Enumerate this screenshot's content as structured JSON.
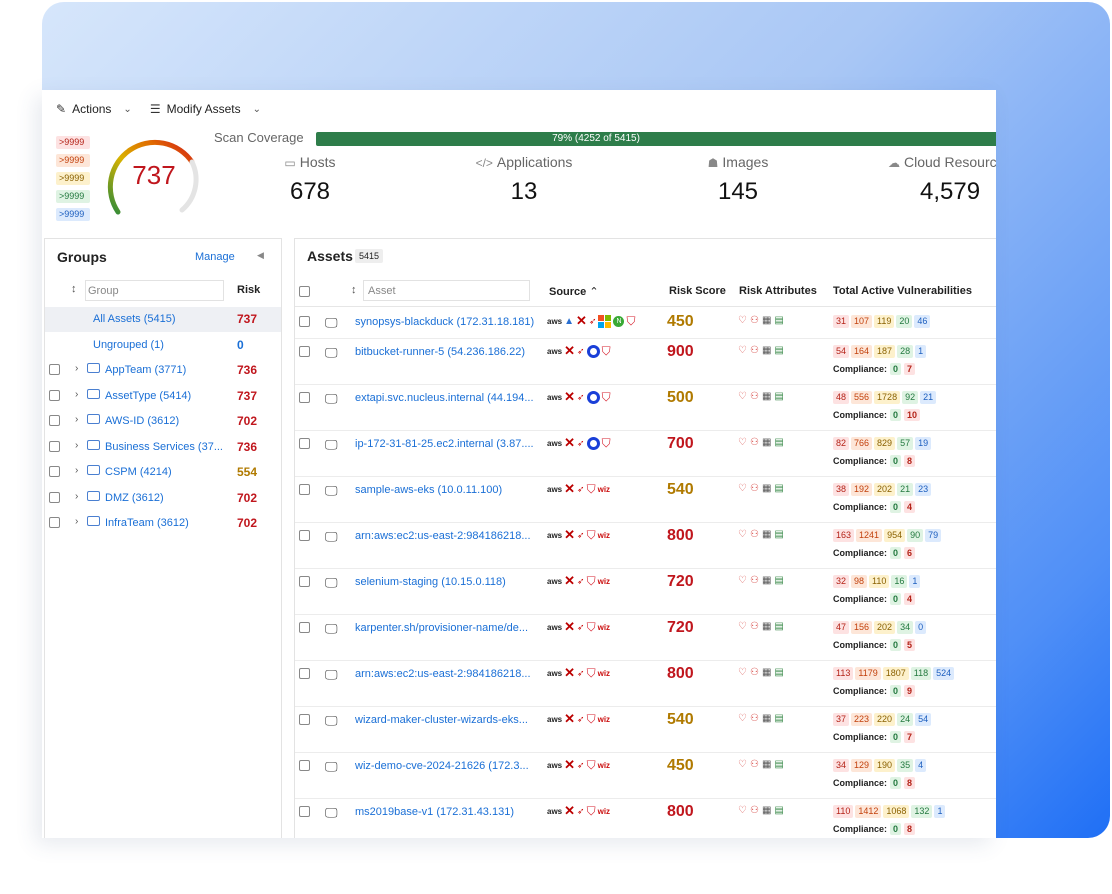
{
  "toolbar": {
    "actions_label": "Actions",
    "modify_label": "Modify Assets"
  },
  "legend": [
    {
      "label": ">9999",
      "color": "#b42318",
      "bg": "#fde2e2"
    },
    {
      "label": ">9999",
      "color": "#c2410c",
      "bg": "#fde6d8"
    },
    {
      "label": ">9999",
      "color": "#8a6100",
      "bg": "#fdf1cc"
    },
    {
      "label": ">9999",
      "color": "#23793f",
      "bg": "#dff3e3"
    },
    {
      "label": ">9999",
      "color": "#1d5fbf",
      "bg": "#dceafd"
    }
  ],
  "gauge": {
    "value": "737"
  },
  "scan": {
    "label": "Scan Coverage",
    "text": "79% (4252 of 5415)",
    "fraction": 0.79
  },
  "stats": [
    {
      "label": "Hosts",
      "value": "678",
      "icon": "monitor-icon"
    },
    {
      "label": "Applications",
      "value": "13",
      "icon": "code-icon"
    },
    {
      "label": "Images",
      "value": "145",
      "icon": "container-icon"
    },
    {
      "label": "Cloud Resources",
      "value": "4,579",
      "icon": "cloud-icon"
    }
  ],
  "groups": {
    "title": "Groups",
    "manage": "Manage",
    "search_placeholder": "Group",
    "risk_header": "Risk",
    "items": [
      {
        "name": "All Assets (5415)",
        "risk": "737",
        "risk_color": "#c0161d",
        "selected": true,
        "checkbox": false,
        "folder": false
      },
      {
        "name": "Ungrouped (1)",
        "risk": "0",
        "risk_color": "#1a6fd6",
        "selected": false,
        "checkbox": false,
        "folder": false
      },
      {
        "name": "AppTeam (3771)",
        "risk": "736",
        "risk_color": "#c0161d",
        "selected": false,
        "checkbox": true,
        "folder": true
      },
      {
        "name": "AssetType (5414)",
        "risk": "737",
        "risk_color": "#c0161d",
        "selected": false,
        "checkbox": true,
        "folder": true
      },
      {
        "name": "AWS-ID (3612)",
        "risk": "702",
        "risk_color": "#c0161d",
        "selected": false,
        "checkbox": true,
        "folder": true
      },
      {
        "name": "Business Services (37...",
        "risk": "736",
        "risk_color": "#c0161d",
        "selected": false,
        "checkbox": true,
        "folder": true
      },
      {
        "name": "CSPM (4214)",
        "risk": "554",
        "risk_color": "#b07a00",
        "selected": false,
        "checkbox": true,
        "folder": true
      },
      {
        "name": "DMZ (3612)",
        "risk": "702",
        "risk_color": "#c0161d",
        "selected": false,
        "checkbox": true,
        "folder": true
      },
      {
        "name": "InfraTeam (3612)",
        "risk": "702",
        "risk_color": "#c0161d",
        "selected": false,
        "checkbox": true,
        "folder": true
      }
    ]
  },
  "assets": {
    "title": "Assets",
    "count": "5415",
    "search_placeholder": "Asset",
    "headers": {
      "source": "Source",
      "score": "Risk Score",
      "attributes": "Risk Attributes",
      "vulns": "Total Active Vulnerabilities"
    },
    "compliance_label": "Compliance:",
    "rows": [
      {
        "name": "synopsys-blackduck (172.31.18.181)",
        "score": "450",
        "score_color": "#b07a00",
        "source": "aws,tri,x,arrow,ms,n,shield",
        "vulns": [
          "31",
          "107",
          "119",
          "20",
          "46"
        ],
        "compliance": null
      },
      {
        "name": "bitbucket-runner-5 (54.236.186.22)",
        "score": "900",
        "score_color": "#c0161d",
        "source": "aws,x,arrow,dot,shield",
        "vulns": [
          "54",
          "164",
          "187",
          "28",
          "1"
        ],
        "compliance": [
          "0",
          "7"
        ]
      },
      {
        "name": "extapi.svc.nucleus.internal (44.194...",
        "score": "500",
        "score_color": "#b07a00",
        "source": "aws,x,arrow,dot,shield",
        "vulns": [
          "48",
          "556",
          "1728",
          "92",
          "21"
        ],
        "compliance": [
          "0",
          "10"
        ]
      },
      {
        "name": "ip-172-31-81-25.ec2.internal (3.87....",
        "score": "700",
        "score_color": "#c0161d",
        "source": "aws,x,arrow,dot,shield",
        "vulns": [
          "82",
          "766",
          "829",
          "57",
          "19"
        ],
        "compliance": [
          "0",
          "8"
        ]
      },
      {
        "name": "sample-aws-eks (10.0.11.100)",
        "score": "540",
        "score_color": "#b07a00",
        "source": "aws,x,arrow,shield,wiz",
        "vulns": [
          "38",
          "192",
          "202",
          "21",
          "23"
        ],
        "compliance": [
          "0",
          "4"
        ]
      },
      {
        "name": "arn:aws:ec2:us-east-2:984186218...",
        "score": "800",
        "score_color": "#c0161d",
        "source": "aws,x,arrow,shield,wiz",
        "vulns": [
          "163",
          "1241",
          "954",
          "90",
          "79"
        ],
        "compliance": [
          "0",
          "6"
        ]
      },
      {
        "name": "selenium-staging (10.15.0.118)",
        "score": "720",
        "score_color": "#c0161d",
        "source": "aws,x,arrow,shield,wiz",
        "vulns": [
          "32",
          "98",
          "110",
          "16",
          "1"
        ],
        "compliance": [
          "0",
          "4"
        ]
      },
      {
        "name": "karpenter.sh/provisioner-name/de...",
        "score": "720",
        "score_color": "#c0161d",
        "source": "aws,x,arrow,shield,wiz",
        "vulns": [
          "47",
          "156",
          "202",
          "34",
          "0"
        ],
        "compliance": [
          "0",
          "5"
        ]
      },
      {
        "name": "arn:aws:ec2:us-east-2:984186218...",
        "score": "800",
        "score_color": "#c0161d",
        "source": "aws,x,arrow,shield,wiz",
        "vulns": [
          "113",
          "1179",
          "1807",
          "118",
          "524"
        ],
        "compliance": [
          "0",
          "9"
        ]
      },
      {
        "name": "wizard-maker-cluster-wizards-eks...",
        "score": "540",
        "score_color": "#b07a00",
        "source": "aws,x,arrow,shield,wiz",
        "vulns": [
          "37",
          "223",
          "220",
          "24",
          "54"
        ],
        "compliance": [
          "0",
          "7"
        ]
      },
      {
        "name": "wiz-demo-cve-2024-21626 (172.3...",
        "score": "450",
        "score_color": "#b07a00",
        "source": "aws,x,arrow,shield,wiz",
        "vulns": [
          "34",
          "129",
          "190",
          "35",
          "4"
        ],
        "compliance": [
          "0",
          "8"
        ]
      },
      {
        "name": "ms2019base-v1 (172.31.43.131)",
        "score": "800",
        "score_color": "#c0161d",
        "source": "aws,x,arrow,shield,wiz",
        "vulns": [
          "110",
          "1412",
          "1068",
          "132",
          "1"
        ],
        "compliance": [
          "0",
          "8"
        ]
      }
    ]
  }
}
